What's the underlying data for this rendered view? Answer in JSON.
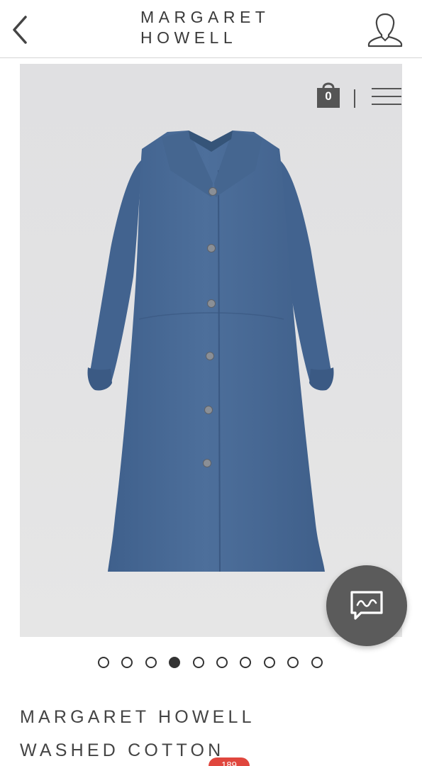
{
  "header": {
    "logo_line1": "MARGARET",
    "logo_line2": "HOWELL"
  },
  "cart": {
    "count": "0"
  },
  "icons": {
    "back": "chevron-left-icon",
    "account": "user-icon",
    "cart": "shopping-bag-icon",
    "menu": "hamburger-icon",
    "chat": "chat-bubble-icon"
  },
  "carousel": {
    "total": 10,
    "active_index": 3
  },
  "product": {
    "title_line1": "MARGARET HOWELL",
    "title_line2": "WASHED COTTON",
    "image_alt": "Blue washed cotton long shirt coat"
  },
  "badge": {
    "count": "189"
  },
  "colors": {
    "coat": "#4a6b96",
    "chat_button": "#5b5b5b",
    "badge": "#e0463d"
  }
}
